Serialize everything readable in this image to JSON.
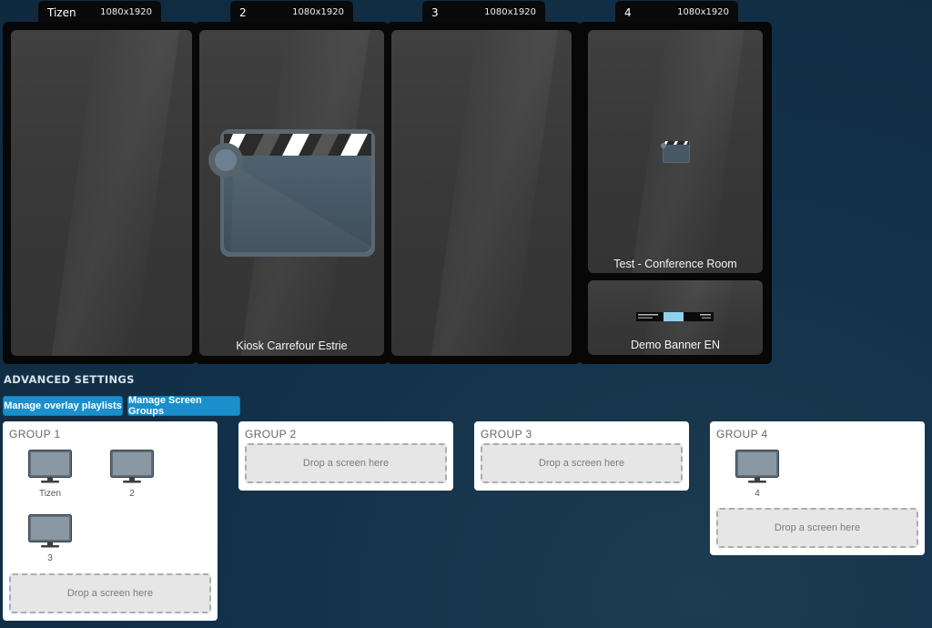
{
  "screens": [
    {
      "name": "Tizen",
      "resolution": "1080x1920"
    },
    {
      "name": "2",
      "resolution": "1080x1920"
    },
    {
      "name": "3",
      "resolution": "1080x1920"
    },
    {
      "name": "4",
      "resolution": "1080x1920"
    }
  ],
  "panels": {
    "screen2_label": "Kiosk Carrefour Estrie",
    "screen4_top_label": "Test - Conference Room",
    "screen4_bottom_label": "Demo Banner EN"
  },
  "advanced": {
    "title": "ADVANCED SETTINGS",
    "overlay_button": "Manage overlay playlists",
    "groups_button": "Manage Screen Groups"
  },
  "groups": [
    {
      "title": "GROUP 1",
      "screens": [
        "Tizen",
        "2",
        "3"
      ],
      "drop_text": "Drop a screen here"
    },
    {
      "title": "GROUP 2",
      "screens": [],
      "drop_text": "Drop a screen here"
    },
    {
      "title": "GROUP 3",
      "screens": [],
      "drop_text": "Drop a screen here"
    },
    {
      "title": "GROUP 4",
      "screens": [
        "4"
      ],
      "drop_text": "Drop a screen here"
    }
  ],
  "colors": {
    "accent": "#1a8fcb",
    "background": "#13314a",
    "panel": "#3a3a3a"
  },
  "icons": {
    "media": "clapperboard-icon",
    "screen": "monitor-icon"
  }
}
